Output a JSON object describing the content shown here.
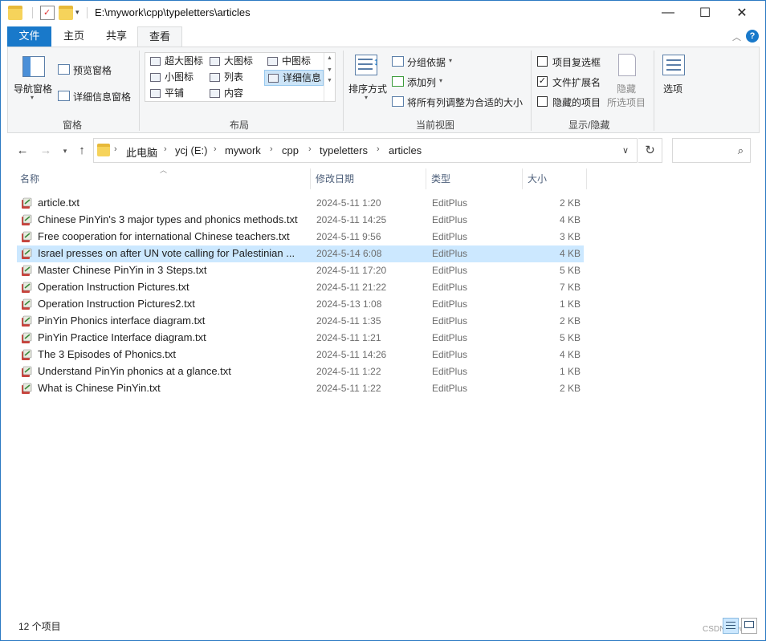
{
  "window": {
    "title": "E:\\mywork\\cpp\\typeletters\\articles",
    "controls": {
      "minimize": "—",
      "maximize": "☐",
      "close": "✕"
    }
  },
  "ribbon_tabs": {
    "file": "文件",
    "items": [
      "主页",
      "共享",
      "查看"
    ],
    "active": "查看",
    "help": "?"
  },
  "ribbon": {
    "panes": {
      "nav_pane": "导航窗格",
      "preview_pane": "预览窗格",
      "details_pane": "详细信息窗格",
      "group_label": "窗格"
    },
    "layout": {
      "items": [
        {
          "label": "超大图标"
        },
        {
          "label": "大图标"
        },
        {
          "label": "中图标"
        },
        {
          "label": "小图标"
        },
        {
          "label": "列表"
        },
        {
          "label": "详细信息"
        },
        {
          "label": "平铺"
        },
        {
          "label": "内容"
        }
      ],
      "selected": "详细信息",
      "group_label": "布局"
    },
    "current_view": {
      "sort_by": "排序方式",
      "group_by": "分组依据",
      "add_column": "添加列",
      "size_all_columns": "将所有列调整为合适的大小",
      "group_label": "当前视图"
    },
    "show_hide": {
      "item_checkboxes": {
        "label": "项目复选框",
        "checked": false
      },
      "file_extensions": {
        "label": "文件扩展名",
        "checked": true
      },
      "hidden_items": {
        "label": "隐藏的项目",
        "checked": false
      },
      "hide_selected_line1": "隐藏",
      "hide_selected_line2": "所选项目",
      "group_label": "显示/隐藏"
    },
    "options": "选项"
  },
  "address_bar": {
    "crumbs": [
      "此电脑",
      "ycj (E:)",
      "mywork",
      "cpp",
      "typeletters",
      "articles"
    ]
  },
  "columns": {
    "name": "名称",
    "date": "修改日期",
    "type": "类型",
    "size": "大小"
  },
  "files": [
    {
      "name": "article.txt",
      "date": "2024-5-11 1:20",
      "type": "EditPlus",
      "size": "2 KB",
      "selected": false
    },
    {
      "name": "Chinese PinYin's 3 major types and phonics methods.txt",
      "date": "2024-5-11 14:25",
      "type": "EditPlus",
      "size": "4 KB",
      "selected": false
    },
    {
      "name": "Free cooperation for international Chinese teachers.txt",
      "date": "2024-5-11 9:56",
      "type": "EditPlus",
      "size": "3 KB",
      "selected": false
    },
    {
      "name": "Israel presses on after UN vote calling for Palestinian ...",
      "date": "2024-5-14 6:08",
      "type": "EditPlus",
      "size": "4 KB",
      "selected": true
    },
    {
      "name": "Master Chinese PinYin in 3 Steps.txt",
      "date": "2024-5-11 17:20",
      "type": "EditPlus",
      "size": "5 KB",
      "selected": false
    },
    {
      "name": "Operation Instruction Pictures.txt",
      "date": "2024-5-11 21:22",
      "type": "EditPlus",
      "size": "7 KB",
      "selected": false
    },
    {
      "name": "Operation Instruction Pictures2.txt",
      "date": "2024-5-13 1:08",
      "type": "EditPlus",
      "size": "1 KB",
      "selected": false
    },
    {
      "name": "PinYin Phonics interface diagram.txt",
      "date": "2024-5-11 1:35",
      "type": "EditPlus",
      "size": "2 KB",
      "selected": false
    },
    {
      "name": "PinYin Practice Interface diagram.txt",
      "date": "2024-5-11 1:21",
      "type": "EditPlus",
      "size": "5 KB",
      "selected": false
    },
    {
      "name": "The 3 Episodes of Phonics.txt",
      "date": "2024-5-11 14:26",
      "type": "EditPlus",
      "size": "4 KB",
      "selected": false
    },
    {
      "name": "Understand PinYin phonics at a glance.txt",
      "date": "2024-5-11 1:22",
      "type": "EditPlus",
      "size": "1 KB",
      "selected": false
    },
    {
      "name": "What is Chinese PinYin.txt",
      "date": "2024-5-11 1:22",
      "type": "EditPlus",
      "size": "2 KB",
      "selected": false
    }
  ],
  "status": {
    "item_count": "12 个项目"
  },
  "watermark": "CSDN @ycjnx",
  "colors": {
    "accent": "#1979ca",
    "selection": "#cce8ff",
    "ribbon_bg": "#f5f6f7"
  }
}
